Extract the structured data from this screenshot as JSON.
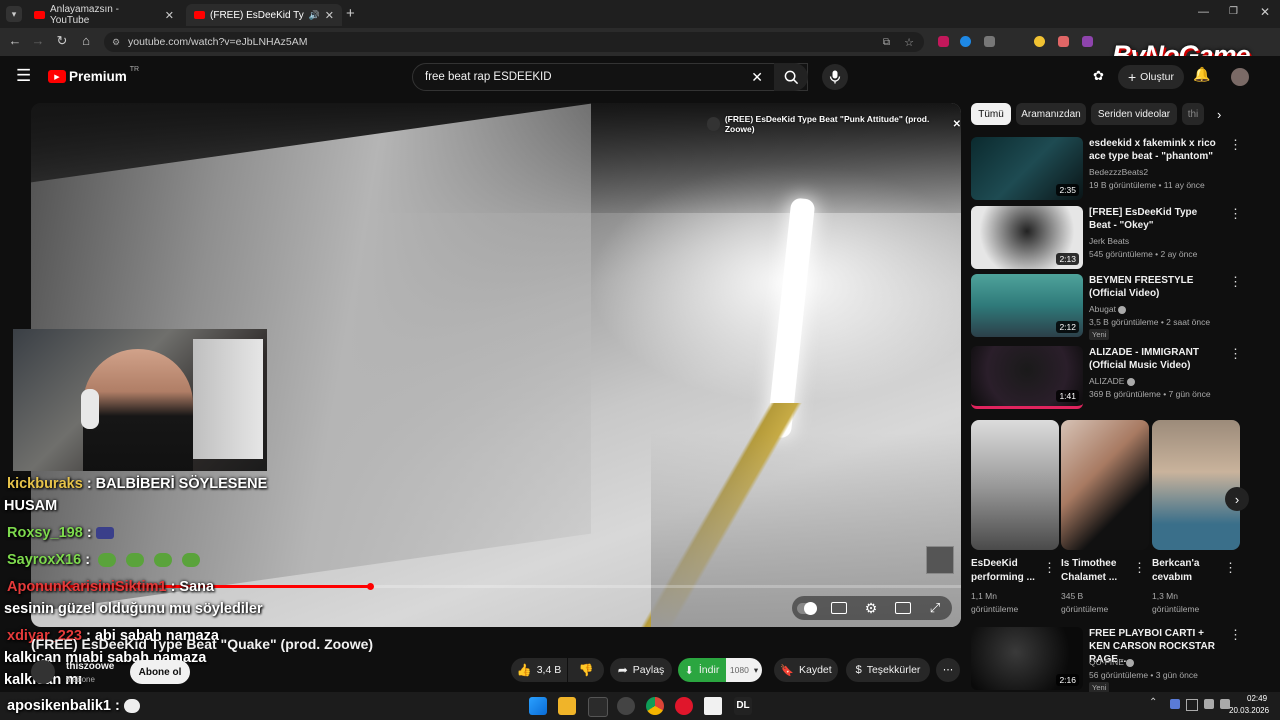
{
  "tabs": [
    {
      "title": "Anlayamazsın - YouTube"
    },
    {
      "title": "(FREE) EsDeeKid Type Beat"
    }
  ],
  "url": "youtube.com/watch?v=eJbLNHAz5AM",
  "watermark": "ByNoGame",
  "header": {
    "logo": "Premium",
    "region": "TR",
    "search_value": "free beat rap ESDEEKID",
    "create_label": "Oluştur"
  },
  "player": {
    "info_title": "(FREE) EsDeeKid Type Beat \"Punk Attitude\" (prod. Zoowe)",
    "progress_fraction": 0.365
  },
  "video": {
    "title": "(FREE) EsDeeKid Type Beat \"Quake\" (prod. Zoowe)",
    "channel": "thiszoowe",
    "subs": "8 abone",
    "subscribe_label": "Abone ol",
    "likes": "3,4 B",
    "share_label": "Paylaş",
    "download_label": "İndir",
    "quality": "1080",
    "save_label": "Kaydet",
    "thanks_label": "Teşekkürler"
  },
  "chat": [
    {
      "user": "kickburaks",
      "text": ": BALBİBERİ SÖYLESENE",
      "text2": "HUSAM",
      "color": "#e6c34a"
    },
    {
      "user": "Roxsy_198",
      "text": ":",
      "color": "#7dd94d"
    },
    {
      "user": "SayroxX16",
      "text": ":",
      "color": "#7dd94d"
    },
    {
      "user": "AponunKarisiniSiktim1",
      "text": ": Sana",
      "text2": "sesinin güzel olduğunu mu söylediler",
      "color": "#e53a3a"
    },
    {
      "user": "xdiyar_223",
      "text": ": abi sabah namaza",
      "text2": "kalkıcan mıabi sabah namaza",
      "text3": "kalkıcan mı",
      "color": "#e53a3a"
    },
    {
      "user": "aposikenbalik1",
      "text": ":",
      "color": "#ffffff"
    }
  ],
  "chips": [
    "Tümü",
    "Aramanızdan",
    "Seriden videolar",
    "thi"
  ],
  "recommendations": [
    {
      "title": "esdeekid x fakemink x rico ace type beat - \"phantom\"",
      "channel": "BedezzzBeats2",
      "meta": "19 B görüntüleme • 11 ay önce",
      "duration": "2:35"
    },
    {
      "title": "[FREE] EsDeeKid Type Beat - \"Okey\"",
      "channel": "Jerk Beats",
      "meta": "545 görüntüleme • 2 ay önce",
      "duration": "2:13"
    },
    {
      "title": "BEYMEN FREESTYLE (Official Video)",
      "channel": "Abugat",
      "meta": "3,5 B görüntüleme • 2 saat önce",
      "badge": "Yeni",
      "duration": "2:12"
    },
    {
      "title": "ALIZADE - IMMIGRANT (Official Music Video)",
      "channel": "ALIZADE",
      "meta": "369 B görüntüleme • 7 gün önce",
      "duration": "1:41"
    }
  ],
  "shorts": [
    {
      "title": "EsDeeKid performing ...",
      "views": "1,1 Mn görüntüleme"
    },
    {
      "title": "Is Timothee Chalamet ...",
      "views": "345 B görüntüleme"
    },
    {
      "title": "Berkcan'a cevabım",
      "views": "1,3 Mn görüntüleme"
    }
  ],
  "last_rec": {
    "title": "FREE PLAYBOI CARTI + KEN CARSON ROCKSTAR RAGE ...",
    "channel": "QU-FINE",
    "meta": "56 görüntüleme • 3 gün önce",
    "badge": "Yeni",
    "duration": "2:16"
  },
  "clock": {
    "time": "02:49",
    "date": "20.03.2026"
  },
  "colors": {
    "accent": "#ff0000",
    "download": "#2ba640"
  }
}
